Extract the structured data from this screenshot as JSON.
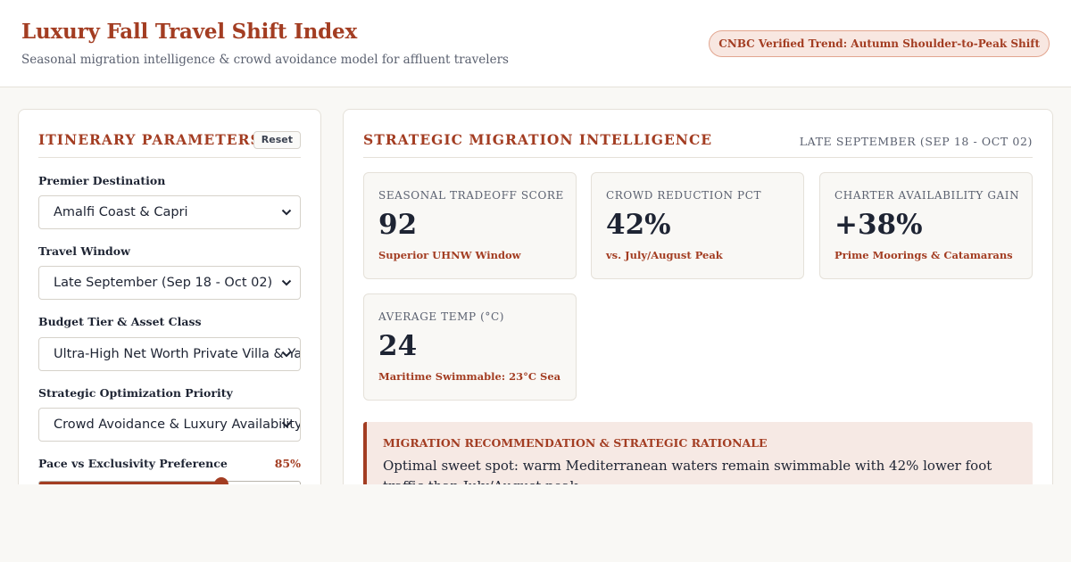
{
  "header": {
    "title": "Luxury Fall Travel Shift Index",
    "subtitle": "Seasonal migration intelligence & crowd avoidance model for affluent travelers",
    "trend_badge": "CNBC Verified Trend: Autumn Shoulder-to-Peak Shift"
  },
  "params": {
    "title": "Itinerary Parameters",
    "reset_label": "Reset",
    "fields": [
      {
        "label": "Premier Destination",
        "value": "Amalfi Coast & Capri"
      },
      {
        "label": "Travel Window",
        "value": "Late September (Sep 18 - Oct 02)"
      },
      {
        "label": "Budget Tier & Asset Class",
        "value": "Ultra-High Net Worth Private Villa & Yacht"
      },
      {
        "label": "Strategic Optimization Priority",
        "value": "Crowd Avoidance & Luxury Availability"
      }
    ],
    "slider": {
      "label": "Pace vs Exclusivity Preference",
      "value_label": "85%",
      "value": 0.7
    }
  },
  "intel": {
    "title": "Strategic Migration Intelligence",
    "date_range": "LATE SEPTEMBER (SEP 18 - OCT 02)",
    "metrics": [
      {
        "label": "Seasonal Tradeoff Score",
        "value": "92",
        "sub": "Superior UHNW Window"
      },
      {
        "label": "Crowd Reduction Pct",
        "value": "42%",
        "sub": "vs. July/August Peak"
      },
      {
        "label": "Charter Availability Gain",
        "value": "+38%",
        "sub": "Prime Moorings & Catamarans"
      },
      {
        "label": "Average Temp (°C)",
        "value": "24",
        "sub": "Maritime Swimmable: 23°C Sea"
      }
    ],
    "recommendation": {
      "title": "MIGRATION RECOMMENDATION & STRATEGIC RATIONALE",
      "text": "Optimal sweet spot: warm Mediterranean waters remain swimmable with 42% lower foot traffic than July/August peak."
    }
  },
  "colors": {
    "accent": "#a33d22",
    "background": "#f9f8f5",
    "card": "#ffffff",
    "text": "#1e2433",
    "muted": "#5b6170",
    "recommendation_bg": "#f6e9e4"
  }
}
